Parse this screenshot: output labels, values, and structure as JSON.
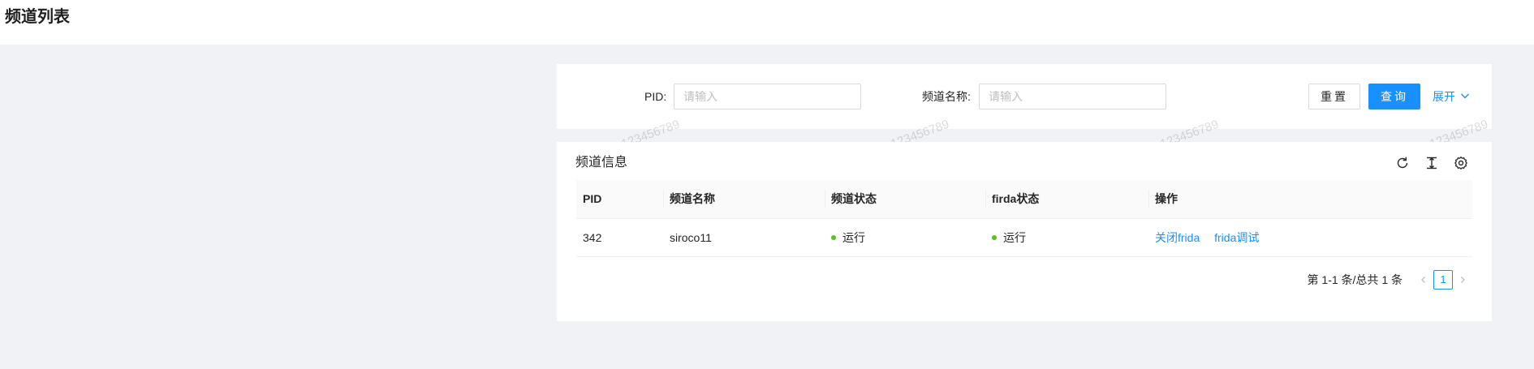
{
  "page": {
    "title": "频道列表"
  },
  "search": {
    "pid_label": "PID:",
    "pid_placeholder": "请输入",
    "name_label": "频道名称:",
    "name_placeholder": "请输入",
    "reset_label": "重置",
    "query_label": "查询",
    "expand_label": "展开"
  },
  "table": {
    "title": "频道信息",
    "columns": [
      "PID",
      "频道名称",
      "频道状态",
      "firda状态",
      "操作"
    ],
    "rows": [
      {
        "pid": "342",
        "name": "siroco11",
        "channel_status": "运行",
        "firda_status": "运行",
        "actions": [
          "关闭frida",
          "frida调试"
        ]
      }
    ],
    "status_color": "#52c41a"
  },
  "pagination": {
    "summary": "第 1-1 条/总共 1 条",
    "current_page": "1"
  },
  "watermark": {
    "text": "123456789"
  },
  "icons": {
    "refresh": "refresh-icon",
    "density": "column-height-icon",
    "settings": "gear-icon",
    "expand": "chevron-down-icon"
  },
  "colors": {
    "primary": "#1890ff",
    "background": "#f0f2f5"
  }
}
